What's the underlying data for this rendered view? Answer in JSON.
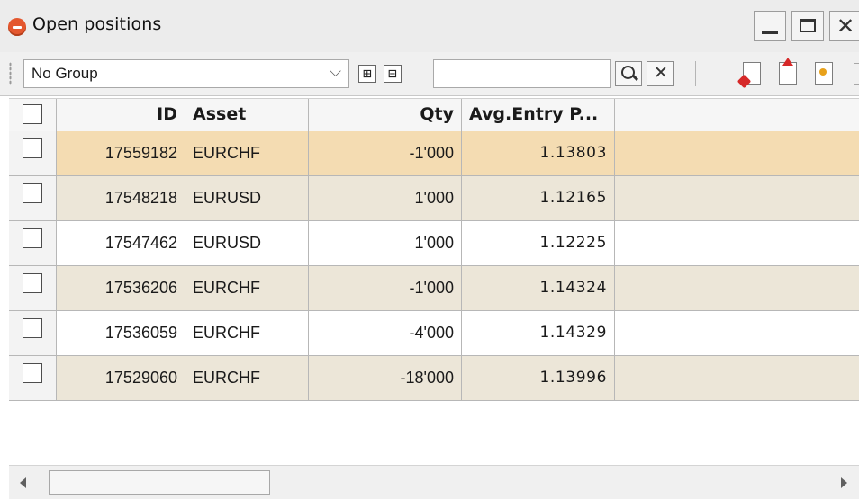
{
  "window": {
    "title": "Open positions",
    "controls": {
      "minimize": "minimize",
      "maximize": "maximize",
      "close": "✕"
    }
  },
  "toolbar": {
    "group_select_value": "No Group",
    "expand_all_glyph": "⊞",
    "collapse_all_glyph": "⊟",
    "search_value": "",
    "search_placeholder": "",
    "clear_glyph": "✕"
  },
  "table": {
    "columns": [
      "ID",
      "Asset",
      "Qty",
      "Avg.Entry P..."
    ],
    "rows": [
      {
        "id": "17559182",
        "asset": "EURCHF",
        "qty": "-1'000",
        "avg_entry": "1.13803"
      },
      {
        "id": "17548218",
        "asset": "EURUSD",
        "qty": "1'000",
        "avg_entry": "1.12165"
      },
      {
        "id": "17547462",
        "asset": "EURUSD",
        "qty": "1'000",
        "avg_entry": "1.12225"
      },
      {
        "id": "17536206",
        "asset": "EURCHF",
        "qty": "-1'000",
        "avg_entry": "1.14324"
      },
      {
        "id": "17536059",
        "asset": "EURCHF",
        "qty": "-4'000",
        "avg_entry": "1.14329"
      },
      {
        "id": "17529060",
        "asset": "EURCHF",
        "qty": "-18'000",
        "avg_entry": "1.13996"
      }
    ]
  },
  "colors": {
    "selected_row": "#f4dcb2",
    "alt_row": "#ece6d8",
    "app_icon": "#e4572e"
  }
}
